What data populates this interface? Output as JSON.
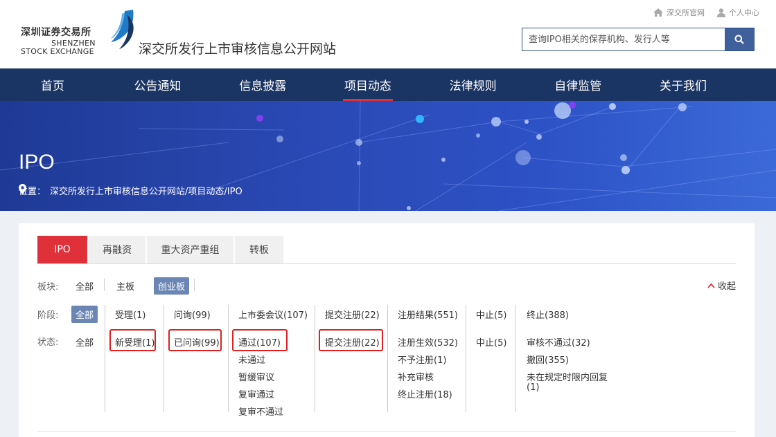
{
  "header": {
    "logo_cn": "深圳证券交易所",
    "logo_en1": "SHENZHEN",
    "logo_en2": "STOCK EXCHANGE",
    "site_title": "深交所发行上市审核信息公开网站",
    "top_links": {
      "official": "深交所官网",
      "user_center": "个人中心"
    },
    "search": {
      "placeholder": "查询IPO相关的保荐机构、发行人等"
    }
  },
  "nav": {
    "items": [
      {
        "label": "首页"
      },
      {
        "label": "公告通知"
      },
      {
        "label": "信息披露"
      },
      {
        "label": "项目动态",
        "active": true
      },
      {
        "label": "法律规则"
      },
      {
        "label": "自律监管"
      },
      {
        "label": "关于我们"
      }
    ]
  },
  "banner": {
    "title": "IPO",
    "breadcrumb_label": "位置：",
    "breadcrumb_path": "深交所发行上市审核信息公开网站/项目动态/IPO"
  },
  "tabs": [
    {
      "label": "IPO",
      "active": true
    },
    {
      "label": "再融资"
    },
    {
      "label": "重大资产重组"
    },
    {
      "label": "转板"
    }
  ],
  "board": {
    "label": "板块:",
    "options": [
      "全部",
      "主板",
      "创业板"
    ],
    "selected": "创业板",
    "collapse_label": "收起"
  },
  "stage": {
    "label": "阶段:",
    "options": [
      "全部",
      "受理(1)",
      "问询(99)",
      "上市委会议(107)",
      "提交注册(22)",
      "注册结果(551)",
      "中止(5)",
      "终止(388)"
    ],
    "selected": "全部"
  },
  "status": {
    "label": "状态:",
    "all": "全部",
    "col1": [
      "新受理(1)"
    ],
    "col2": [
      "已问询(99)"
    ],
    "col3": [
      "通过(107)",
      "未通过",
      "暂缓审议",
      "复审通过",
      "复审不通过"
    ],
    "col4": [
      "提交注册(22)"
    ],
    "col5": [
      "注册生效(532)",
      "不予注册(1)",
      "补充审核",
      "终止注册(18)"
    ],
    "col6": [
      "中止(5)"
    ],
    "col7": [
      "审核不通过(32)",
      "撤回(355)",
      "未在规定时限内回复",
      "(1)"
    ]
  },
  "colors": {
    "nav_bg": "#1a3463",
    "accent_red": "#e0303a",
    "selected_bg": "#6b86b5"
  }
}
